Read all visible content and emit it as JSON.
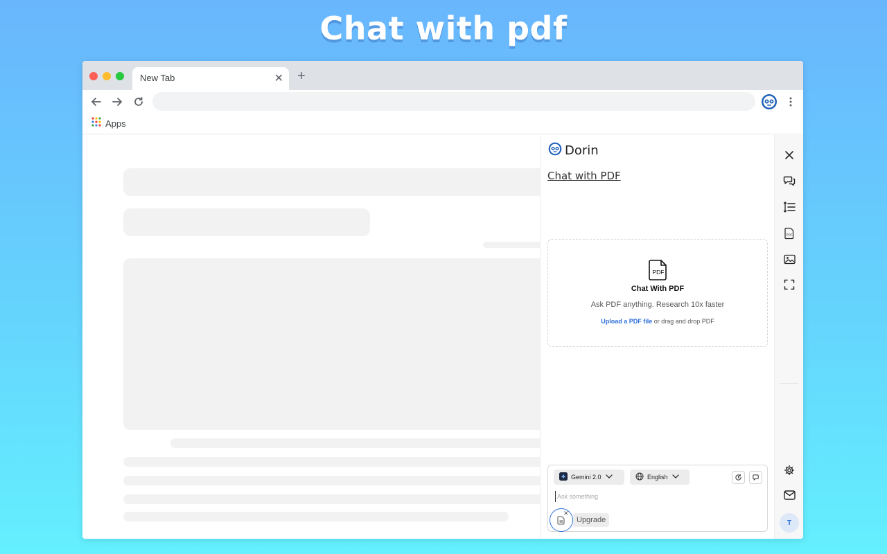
{
  "hero": {
    "title": "Chat with pdf"
  },
  "browser": {
    "tab": {
      "title": "New Tab",
      "close_icon": "close-icon"
    },
    "new_tab_icon": "plus-icon",
    "nav": {
      "back_icon": "arrow-left-icon",
      "forward_icon": "arrow-right-icon",
      "reload_icon": "reload-icon"
    },
    "omnibox": {
      "value": ""
    },
    "extension_icon": "dorin-robot-icon",
    "menu_icon": "kebab-menu-icon",
    "bookmarks": {
      "apps_label": "Apps",
      "apps_icon": "apps-grid-icon"
    },
    "window_controls": {
      "close_color": "#fe5f57",
      "minimize_color": "#febc2e",
      "maximize_color": "#28c840"
    }
  },
  "panel": {
    "brand": {
      "name": "Dorin",
      "logo_icon": "dorin-robot-icon"
    },
    "heading": "Chat with PDF",
    "dropzone": {
      "icon": "pdf-file-icon",
      "icon_text": "PDF",
      "title": "Chat With PDF",
      "subtitle": "Ask PDF anything. Research 10x faster",
      "upload_link": "Upload a PDF file",
      "upload_rest": " or drag and drop PDF"
    },
    "chat": {
      "model": {
        "label": "Gemini 2.0",
        "icon": "gemini-sparkle-icon",
        "chevron": "chevron-down-icon"
      },
      "language": {
        "label": "English",
        "icon": "globe-icon",
        "chevron": "chevron-down-icon"
      },
      "history_icon": "history-icon",
      "new_chat_icon": "chat-bubble-icon",
      "input": {
        "placeholder": "Ask something",
        "value": ""
      },
      "attach_icon": "document-icon",
      "attach_remove_icon": "close-icon",
      "upgrade_label": "Upgrade"
    },
    "accent_color": "#2e6fd8"
  },
  "rail": {
    "items": [
      {
        "name": "close-icon"
      },
      {
        "name": "chat-icon"
      },
      {
        "name": "summary-list-icon"
      },
      {
        "name": "pdf-icon"
      },
      {
        "name": "image-icon"
      },
      {
        "name": "screenshot-icon"
      }
    ],
    "bottom": [
      {
        "name": "settings-icon"
      },
      {
        "name": "mail-icon"
      }
    ],
    "avatar_initial": "T"
  }
}
